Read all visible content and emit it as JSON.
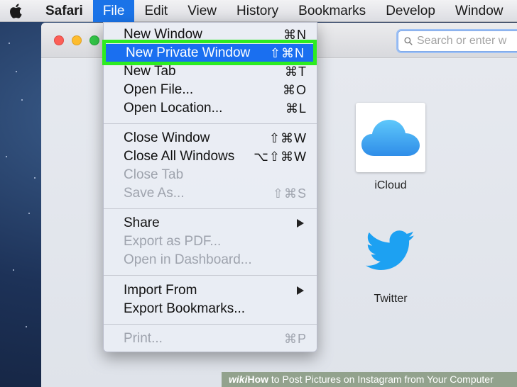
{
  "menubar": {
    "app_name": "Safari",
    "items": [
      "File",
      "Edit",
      "View",
      "History",
      "Bookmarks",
      "Develop",
      "Window"
    ]
  },
  "search": {
    "placeholder": "Search or enter w"
  },
  "favorites": [
    {
      "label": "iCloud",
      "icon": "icloud-icon"
    },
    {
      "label": "Twitter",
      "icon": "twitter-icon"
    }
  ],
  "file_menu": {
    "items": [
      {
        "label": "New Window",
        "shortcut": "⌘N",
        "enabled": true
      },
      {
        "label": "New Private Window",
        "shortcut": "⇧⌘N",
        "enabled": true,
        "highlighted": true
      },
      {
        "label": "New Tab",
        "shortcut": "⌘T",
        "enabled": true
      },
      {
        "label": "Open File...",
        "shortcut": "⌘O",
        "enabled": true
      },
      {
        "label": "Open Location...",
        "shortcut": "⌘L",
        "enabled": true
      },
      {
        "label": "Close Window",
        "shortcut": "⇧⌘W",
        "enabled": true
      },
      {
        "label": "Close All Windows",
        "shortcut": "⌥⇧⌘W",
        "enabled": true
      },
      {
        "label": "Close Tab",
        "shortcut": "",
        "enabled": false
      },
      {
        "label": "Save As...",
        "shortcut": "⇧⌘S",
        "enabled": false
      },
      {
        "label": "Share",
        "submenu": true,
        "enabled": true
      },
      {
        "label": "Export as PDF...",
        "shortcut": "",
        "enabled": false
      },
      {
        "label": "Open in Dashboard...",
        "shortcut": "",
        "enabled": false
      },
      {
        "label": "Import From",
        "submenu": true,
        "enabled": true
      },
      {
        "label": "Export Bookmarks...",
        "shortcut": "",
        "enabled": true
      },
      {
        "label": "Print...",
        "shortcut": "⌘P",
        "enabled": false
      }
    ]
  },
  "watermark": {
    "brand": "wiki",
    "prefix": "How",
    "text": " to Post Pictures on Instagram from Your Computer"
  },
  "colors": {
    "highlight": "#1a6ff0",
    "annotation_box": "#2dec20",
    "menu_active": "#1a73e8"
  }
}
